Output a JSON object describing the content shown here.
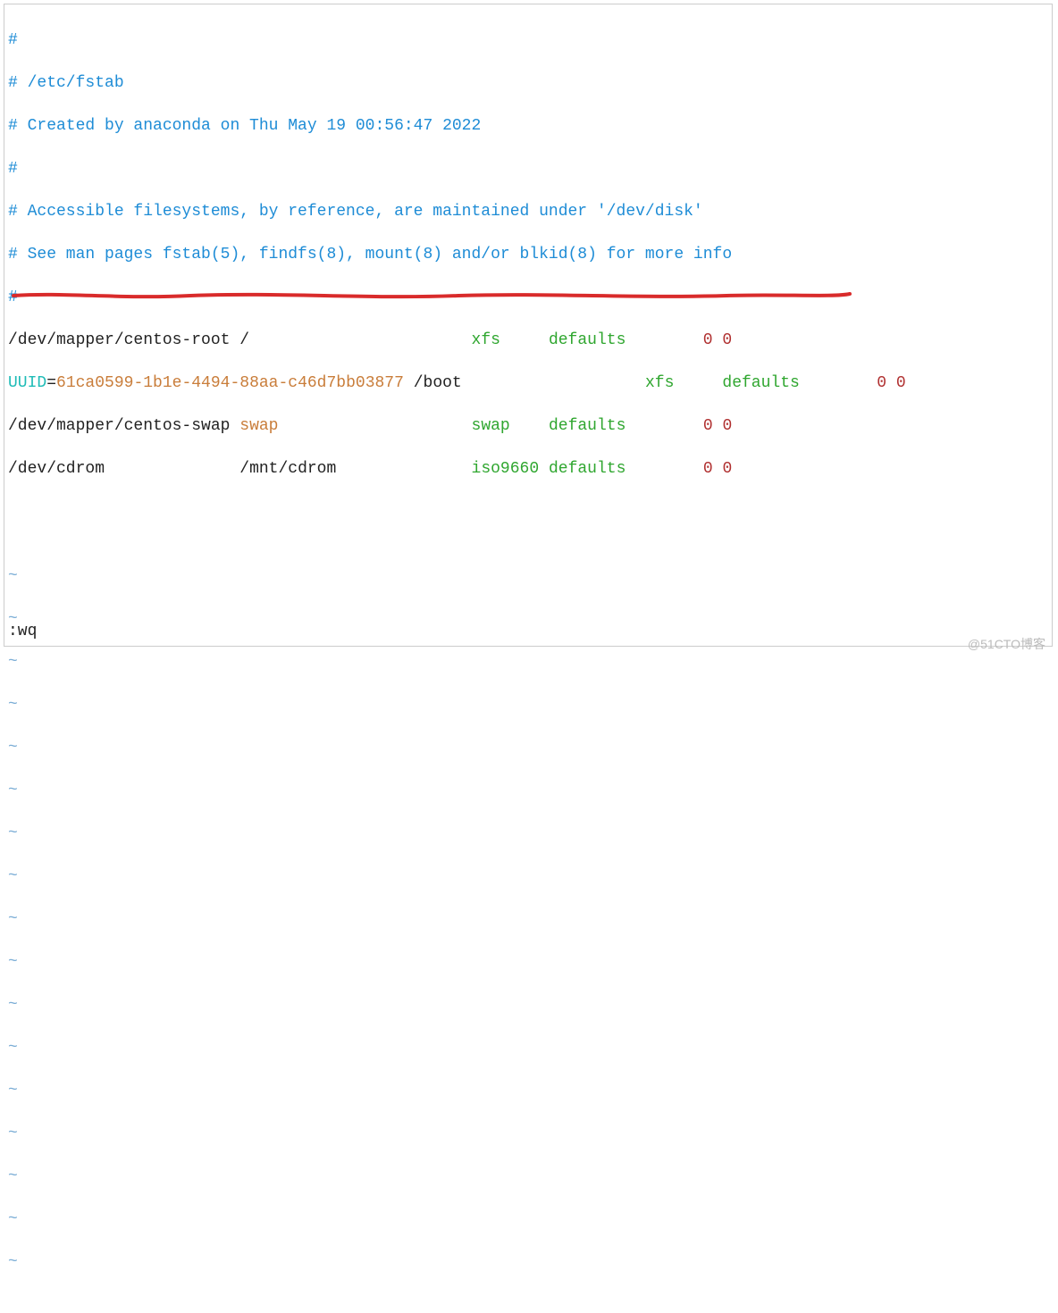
{
  "comments": {
    "l1": "#",
    "l2": "# /etc/fstab",
    "l3": "# Created by anaconda on Thu May 19 00:56:47 2022",
    "l4": "#",
    "l5": "# Accessible filesystems, by reference, are maintained under '/dev/disk'",
    "l6": "# See man pages fstab(5), findfs(8), mount(8) and/or blkid(8) for more info",
    "l7": "#"
  },
  "entries": {
    "root": {
      "device": "/dev/mapper/centos-root",
      "mount": "/",
      "fstype": "xfs",
      "options": "defaults",
      "dump": "0",
      "pass": "0"
    },
    "boot": {
      "uuid_key": "UUID",
      "equals": "=",
      "uuid": "61ca0599-1b1e-4494-88aa-c46d7bb03877",
      "mount": "/boot",
      "fstype": "xfs",
      "options": "defaults",
      "dump": "0",
      "pass": "0"
    },
    "swap": {
      "device": "/dev/mapper/centos-swap",
      "mount": "swap",
      "fstype": "swap",
      "options": "defaults",
      "dump": "0",
      "pass": "0"
    },
    "cdrom": {
      "device": "/dev/cdrom",
      "mount": "/mnt/cdrom",
      "fstype": "iso9660",
      "options": "defaults",
      "dump": "0",
      "pass": "0"
    }
  },
  "tilde": "~",
  "status": ":wq",
  "watermark": "@51CTO博客"
}
